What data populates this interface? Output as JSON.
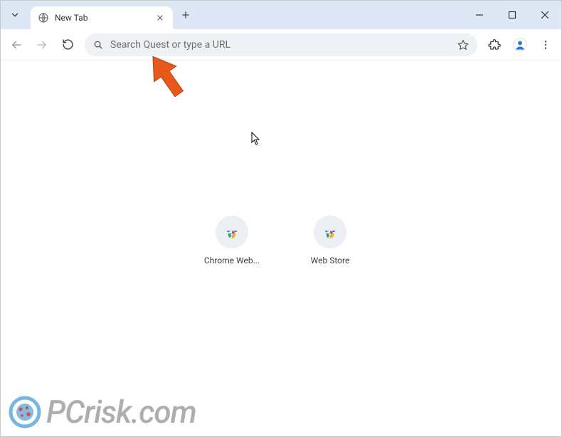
{
  "title_bar": {
    "tab_title": "New Tab"
  },
  "omnibox": {
    "placeholder": "Search Quest or type a URL"
  },
  "shortcuts": [
    {
      "label": "Chrome Web..."
    },
    {
      "label": "Web Store"
    }
  ],
  "watermark": {
    "text": "PCrisk.com"
  }
}
